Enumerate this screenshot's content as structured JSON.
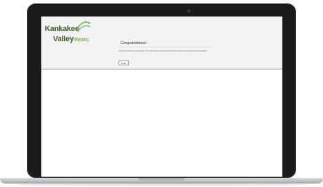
{
  "logo": {
    "line1": "Kankakee",
    "line2_a": "Valley",
    "line2_b": "REMC",
    "colors": {
      "dark_green": "#3f5a2c",
      "light_green": "#7db842",
      "teal": "#5bb8b0"
    }
  },
  "card": {
    "title": "Congratulations!",
    "message": "Your input letter to complete. You will receive an email with instructions for setting your password.",
    "login_label": "Login"
  }
}
